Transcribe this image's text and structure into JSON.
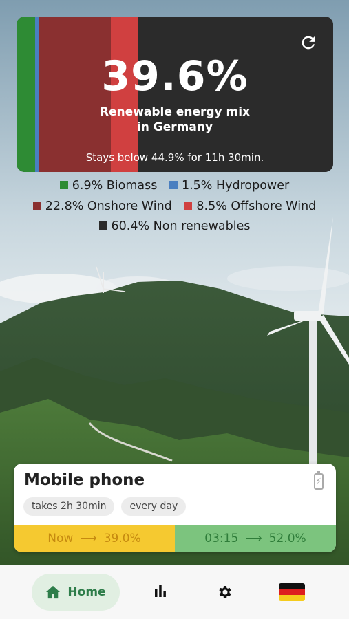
{
  "mix": {
    "percentage": "39.6%",
    "title": "Renewable energy mix in Germany",
    "stays_text": "Stays below 44.9% for 11h 30min.",
    "segments": [
      {
        "name": "Biomass",
        "share": 6.9,
        "color": "#2e8b34"
      },
      {
        "name": "Hydropower",
        "share": 1.5,
        "color": "#4a7fc0"
      },
      {
        "name": "Onshore Wind",
        "share": 22.8,
        "color": "#8a3030"
      },
      {
        "name": "Offshore Wind",
        "share": 8.5,
        "color": "#d04040"
      },
      {
        "name": "Non renewables",
        "share": 60.4,
        "color": "#2b2b2b"
      }
    ]
  },
  "legend": {
    "biomass": "6.9% Biomass",
    "hydropower": "1.5% Hydropower",
    "onshore": "22.8% Onshore Wind",
    "offshore": "8.5% Offshore Wind",
    "nonrenew": "60.4% Non renewables"
  },
  "device": {
    "name": "Mobile phone",
    "duration": "takes 2h 30min",
    "frequency": "every day",
    "now_label": "Now",
    "now_value": "39.0%",
    "best_time": "03:15",
    "best_value": "52.0%",
    "arrow": "⟶"
  },
  "nav": {
    "home_label": "Home"
  },
  "colors": {
    "accent_green": "#2e7d4a",
    "now_yellow": "#f5c930",
    "best_green": "#7cc47e"
  }
}
